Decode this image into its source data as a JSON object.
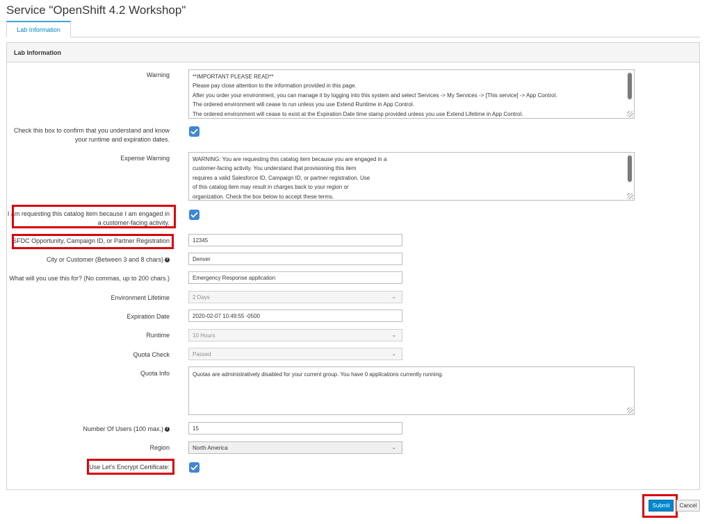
{
  "page": {
    "title": "Service \"OpenShift 4.2 Workshop\""
  },
  "tabs": [
    {
      "label": "Lab Information",
      "active": true
    }
  ],
  "panel": {
    "heading": "Lab Information"
  },
  "fields": {
    "warning": {
      "label": "Warning",
      "lines": [
        "**IMPORTANT PLEASE READ**",
        "Please pay close attention to the information provided in this page.",
        "After you order your environment, you can manage it by logging into this system and select Services -> My Services -> [This service] -> App Control.",
        "The ordered environment will cease to run unless you use Extend Runtime in App Control.",
        "The ordered environment will cease to exist at the Expiration Date time stamp provided unless you use Extend Lifetime in App Control."
      ]
    },
    "confirm_runtime": {
      "label_line1": "Check this box to confirm that you understand and know",
      "label_line2": "your runtime and expiration dates.",
      "checked": true
    },
    "expense_warning": {
      "label": "Expense Warning",
      "lines": [
        "WARNING: You are requesting this catalog item because you are engaged in a",
        "customer-facing activity. You understand that provisioning this item",
        "requires a valid Salesforce ID, Campaign ID, or partner registration. Use",
        "of this catalog item may result in charges back to your region or",
        "organization. Check the box below to accept these terms."
      ]
    },
    "customer_facing": {
      "label_line1": "I am requesting this catalog item because I am engaged in",
      "label_line2": "a customer-facing activity.",
      "checked": true
    },
    "sfdc": {
      "label": "SFDC Opportunity, Campaign ID, or Partner Registration",
      "value": "12345"
    },
    "city": {
      "label": "City or Customer (Between 3 and 8 chars)",
      "value": "Denver"
    },
    "purpose": {
      "label": "What will you use this for? (No commas, up to 200 chars.)",
      "value": "Emergency Response application"
    },
    "lifetime": {
      "label": "Environment Lifetime",
      "value": "2 Days"
    },
    "expiration": {
      "label": "Expiration Date",
      "value": "2020-02-07 10:49:55 -0500"
    },
    "runtime": {
      "label": "Runtime",
      "value": "10 Hours"
    },
    "quota_check": {
      "label": "Quota Check",
      "value": "Passed"
    },
    "quota_info": {
      "label": "Quota Info",
      "value": "Quotas are administratively disabled for your current group.  You have 0 applications currently running."
    },
    "num_users": {
      "label": "Number Of Users (100 max.)",
      "value": "15"
    },
    "region": {
      "label": "Region",
      "value": "North America"
    },
    "letsencrypt": {
      "label": "Use Let's Encrypt Certificate:",
      "checked": true
    }
  },
  "buttons": {
    "submit": "Submit",
    "cancel": "Cancel"
  },
  "colors": {
    "accent": "#0088ce",
    "checkbox": "#3e87d4",
    "highlight": "#d8000c"
  }
}
